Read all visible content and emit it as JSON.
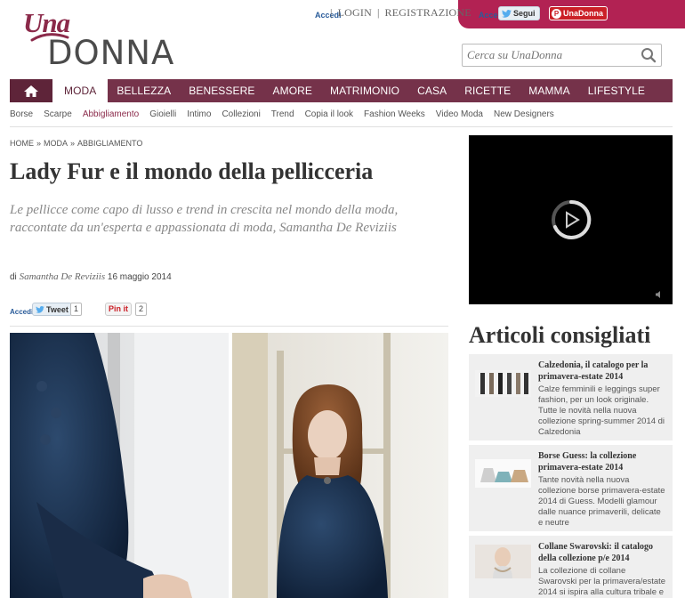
{
  "topbar": {
    "accedi_left": "Accedi",
    "login": "LOGIN",
    "separator": "|",
    "register": "REGISTRAZIONE",
    "accedi_right": "Accedi",
    "twitter_follow": "Segui",
    "pinterest_account": "UnaDonna",
    "pink_color": "#b22253"
  },
  "logo": {
    "una": "Una",
    "donna": "DONNA"
  },
  "search": {
    "placeholder": "Cerca su UnaDonna"
  },
  "nav": {
    "items": [
      "MODA",
      "BELLEZZA",
      "BENESSERE",
      "AMORE",
      "MATRIMONIO",
      "CASA",
      "RICETTE",
      "MAMMA",
      "LIFESTYLE"
    ],
    "active": "MODA",
    "color": "#75324a"
  },
  "subnav": {
    "items": [
      "Borse",
      "Scarpe",
      "Abbigliamento",
      "Gioielli",
      "Intimo",
      "Collezioni",
      "Trend",
      "Copia il look",
      "Fashion Weeks",
      "Video Moda",
      "New Designers"
    ],
    "active": "Abbigliamento"
  },
  "breadcrumb": [
    "HOME",
    "»",
    "MODA",
    "»",
    "ABBIGLIAMENTO"
  ],
  "article": {
    "title": "Lady Fur e il mondo della pellicceria",
    "subtitle": "Le pellicce come capo di lusso e trend in crescita nel mondo della moda, raccontate da un'esperta e appassionata di moda, Samantha De Reviziis",
    "by": "di",
    "author": "Samantha De Reviziis",
    "date": "16 maggio 2014"
  },
  "share": {
    "accedi": "Accedi",
    "tweet": "Tweet",
    "tweet_count": "1",
    "pin": "Pin it",
    "pin_count": "2"
  },
  "sidebar": {
    "section_title": "Articoli consigliati",
    "articles": [
      {
        "title": "Calzedonia, il catalogo per la primavera-estate 2014",
        "desc": "Calze femminili e leggings super fashion, per un look originale. Tutte le novità nella nuova collezione spring-summer 2014 di Calzedonia"
      },
      {
        "title": "Borse Guess: la collezione primavera-estate 2014",
        "desc": "Tante novità nella nuova collezione borse primavera-estate 2014 di Guess. Modelli glamour dalle nuance primaverili, delicate e neutre"
      },
      {
        "title": "Collane Swarovski: il catalogo della collezione p/e 2014",
        "desc": "La collezione di collane Swarovski per la primavera/estate 2014 si ispira alla cultura tribale e alla"
      }
    ]
  }
}
